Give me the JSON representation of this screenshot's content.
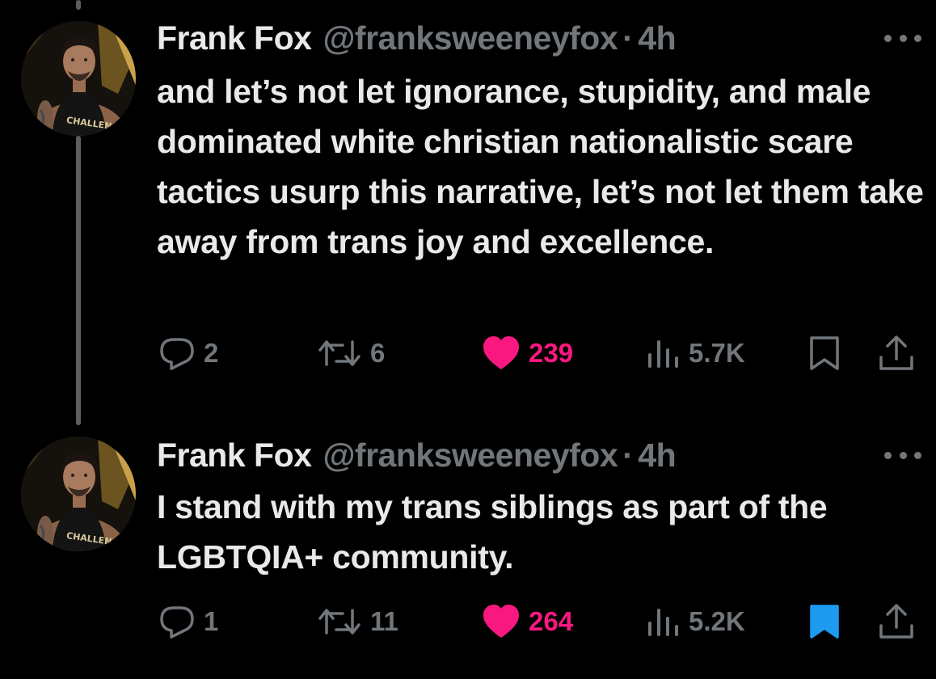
{
  "tweets": [
    {
      "name": "Frank Fox",
      "handle": "@franksweeneyfox",
      "dot": "·",
      "time": "4h",
      "text": "and let’s not let ignorance, stupidity, and male dominated white christian nationalistic scare tactics usurp this narrative, let’s not let them take away from trans joy and excellence.",
      "replies": "2",
      "reposts": "6",
      "likes": "239",
      "views": "5.7K",
      "bookmarked": false,
      "avatar_shirt_text": "CHALLENGE"
    },
    {
      "name": "Frank Fox",
      "handle": "@franksweeneyfox",
      "dot": "·",
      "time": "4h",
      "text": "I stand with my trans siblings as part of the LGBTQIA+ community.",
      "replies": "1",
      "reposts": "11",
      "likes": "264",
      "views": "5.2K",
      "bookmarked": true,
      "avatar_shirt_text": "CHALLENGE"
    }
  ],
  "colors": {
    "background": "#000000",
    "text": "#e7e9ea",
    "muted": "#71767b",
    "like": "#f91880",
    "bookmark_active": "#1d9bf0"
  },
  "icons": [
    "reply-icon",
    "repost-icon",
    "heart-icon",
    "views-icon",
    "bookmark-icon",
    "share-icon",
    "more-icon"
  ]
}
